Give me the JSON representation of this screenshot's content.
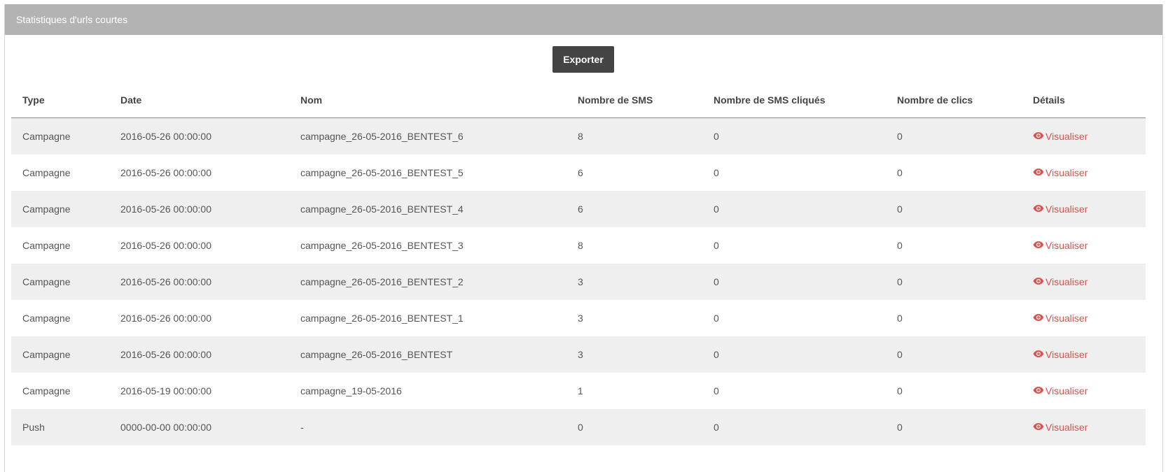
{
  "panel": {
    "title": "Statistiques d'urls courtes"
  },
  "toolbar": {
    "export_label": "Exporter"
  },
  "table": {
    "headers": [
      "Type",
      "Date",
      "Nom",
      "Nombre de SMS",
      "Nombre de SMS cliqués",
      "Nombre de clics",
      "Détails"
    ],
    "rows": [
      {
        "type": "Campagne",
        "date": "2016-05-26 00:00:00",
        "nom": "campagne_26-05-2016_BENTEST_6",
        "sms": "8",
        "sms_clicked": "0",
        "clicks": "0",
        "details": "Visualiser"
      },
      {
        "type": "Campagne",
        "date": "2016-05-26 00:00:00",
        "nom": "campagne_26-05-2016_BENTEST_5",
        "sms": "6",
        "sms_clicked": "0",
        "clicks": "0",
        "details": "Visualiser"
      },
      {
        "type": "Campagne",
        "date": "2016-05-26 00:00:00",
        "nom": "campagne_26-05-2016_BENTEST_4",
        "sms": "6",
        "sms_clicked": "0",
        "clicks": "0",
        "details": "Visualiser"
      },
      {
        "type": "Campagne",
        "date": "2016-05-26 00:00:00",
        "nom": "campagne_26-05-2016_BENTEST_3",
        "sms": "8",
        "sms_clicked": "0",
        "clicks": "0",
        "details": "Visualiser"
      },
      {
        "type": "Campagne",
        "date": "2016-05-26 00:00:00",
        "nom": "campagne_26-05-2016_BENTEST_2",
        "sms": "3",
        "sms_clicked": "0",
        "clicks": "0",
        "details": "Visualiser"
      },
      {
        "type": "Campagne",
        "date": "2016-05-26 00:00:00",
        "nom": "campagne_26-05-2016_BENTEST_1",
        "sms": "3",
        "sms_clicked": "0",
        "clicks": "0",
        "details": "Visualiser"
      },
      {
        "type": "Campagne",
        "date": "2016-05-26 00:00:00",
        "nom": "campagne_26-05-2016_BENTEST",
        "sms": "3",
        "sms_clicked": "0",
        "clicks": "0",
        "details": "Visualiser"
      },
      {
        "type": "Campagne",
        "date": "2016-05-19 00:00:00",
        "nom": "campagne_19-05-2016",
        "sms": "1",
        "sms_clicked": "0",
        "clicks": "0",
        "details": "Visualiser"
      },
      {
        "type": "Push",
        "date": "0000-00-00 00:00:00",
        "nom": "-",
        "sms": "0",
        "sms_clicked": "0",
        "clicks": "0",
        "details": "Visualiser"
      }
    ]
  },
  "icons": {
    "details_icon": "eye-icon"
  },
  "colors": {
    "header_bg": "#b3b3b3",
    "button_bg": "#444444",
    "link": "#d9534f",
    "row_stripe": "#efefef"
  }
}
